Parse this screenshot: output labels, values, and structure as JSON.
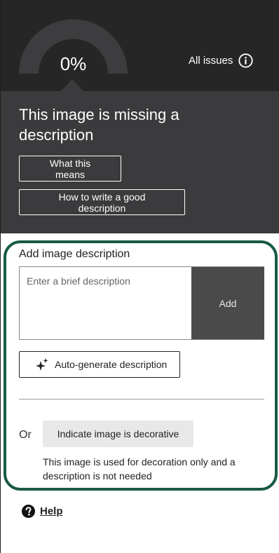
{
  "score": {
    "value": "0%",
    "percent": 0
  },
  "header": {
    "all_issues_label": "All issues"
  },
  "issue": {
    "title": "This image is missing a description",
    "what_this_means_label": "What this means",
    "how_to_write_label": "How to write a good description"
  },
  "description": {
    "label": "Add image description",
    "placeholder": "Enter a brief description",
    "add_label": "Add",
    "autogen_label": "Auto-generate description"
  },
  "decorative": {
    "or_label": "Or",
    "button_label": "Indicate image is decorative",
    "note": "This image is used for decoration only and a description is not needed"
  },
  "help": {
    "label": "Help"
  },
  "colors": {
    "dark_band": "#262626",
    "issue_band": "#3b3b3d",
    "panel_border": "#195a45",
    "add_button": "#4a4a4a"
  }
}
